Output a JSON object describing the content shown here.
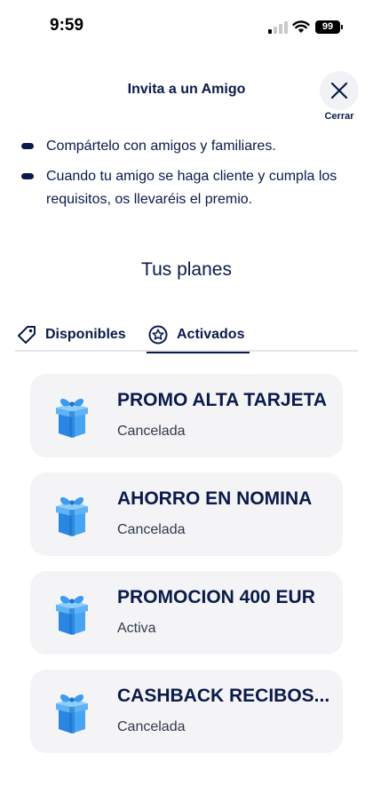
{
  "status_bar": {
    "time": "9:59",
    "battery": "99"
  },
  "header": {
    "title": "Invita a un Amigo",
    "close_label": "Cerrar"
  },
  "bullets": [
    "Compártelo con amigos y familiares.",
    "Cuando tu amigo se haga cliente y cumpla los requisitos, os llevaréis el premio."
  ],
  "section_title": "Tus planes",
  "tabs": [
    {
      "label": "Disponibles",
      "icon": "tag-icon",
      "active": false
    },
    {
      "label": "Activados",
      "icon": "star-circle-icon",
      "active": true
    }
  ],
  "plans": [
    {
      "title": "PROMO ALTA TARJETA",
      "status": "Cancelada",
      "icon": "gift-icon"
    },
    {
      "title": "AHORRO EN NOMINA",
      "status": "Cancelada",
      "icon": "gift-icon"
    },
    {
      "title": "PROMOCION 400 EUR",
      "status": "Activa",
      "icon": "gift-icon"
    },
    {
      "title": "CASHBACK RECIBOS...",
      "status": "Cancelada",
      "icon": "gift-icon"
    }
  ],
  "colors": {
    "primary": "#0a1a4a",
    "card_bg": "#f4f4f6",
    "gift_blue": "#2b8be6"
  }
}
